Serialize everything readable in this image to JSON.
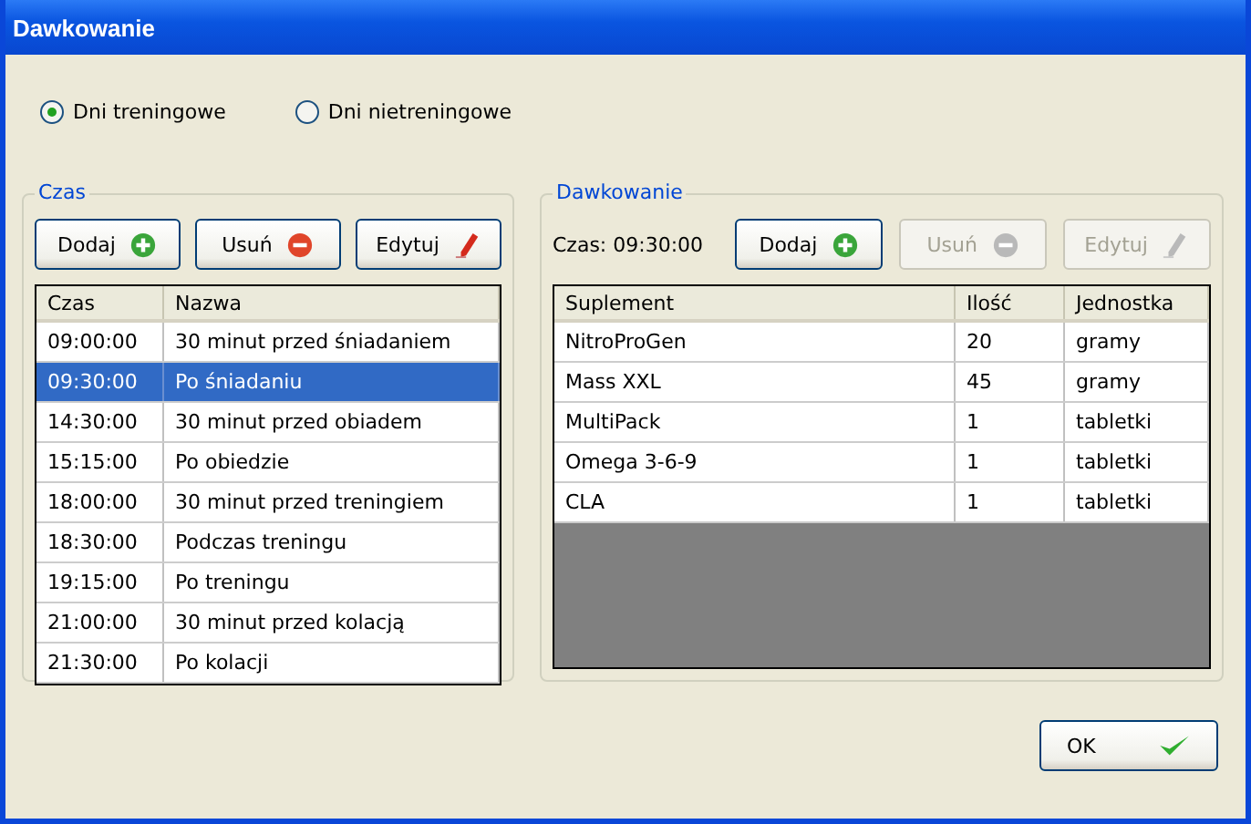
{
  "window": {
    "title": "Dawkowanie"
  },
  "day_types": [
    {
      "label": "Dni treningowe",
      "selected": true
    },
    {
      "label": "Dni nietreningowe",
      "selected": false
    }
  ],
  "time_group": {
    "title": "Czas",
    "buttons": [
      {
        "label": "Dodaj",
        "kind": "add",
        "disabled": false
      },
      {
        "label": "Usuń",
        "kind": "remove",
        "disabled": false
      },
      {
        "label": "Edytuj",
        "kind": "edit",
        "disabled": false
      }
    ],
    "table": {
      "columns": [
        "Czas",
        "Nazwa"
      ],
      "rows": [
        {
          "cells": [
            "09:00:00",
            "30 minut przed śniadaniem"
          ],
          "selected": false
        },
        {
          "cells": [
            "09:30:00",
            "Po śniadaniu"
          ],
          "selected": true
        },
        {
          "cells": [
            "14:30:00",
            "30 minut przed obiadem"
          ],
          "selected": false
        },
        {
          "cells": [
            "15:15:00",
            "Po obiedzie"
          ],
          "selected": false
        },
        {
          "cells": [
            "18:00:00",
            "30 minut przed treningiem"
          ],
          "selected": false
        },
        {
          "cells": [
            "18:30:00",
            "Podczas treningu"
          ],
          "selected": false
        },
        {
          "cells": [
            "19:15:00",
            "Po treningu"
          ],
          "selected": false
        },
        {
          "cells": [
            "21:00:00",
            "30 minut przed kolacją"
          ],
          "selected": false
        },
        {
          "cells": [
            "21:30:00",
            "Po kolacji"
          ],
          "selected": false
        }
      ]
    }
  },
  "dose_group": {
    "title": "Dawkowanie",
    "time_label": "Czas: 09:30:00",
    "buttons": [
      {
        "label": "Dodaj",
        "kind": "add",
        "disabled": false
      },
      {
        "label": "Usuń",
        "kind": "remove",
        "disabled": true
      },
      {
        "label": "Edytuj",
        "kind": "edit",
        "disabled": true
      }
    ],
    "table": {
      "columns": [
        "Suplement",
        "Ilość",
        "Jednostka"
      ],
      "rows": [
        {
          "cells": [
            "NitroProGen",
            "20",
            "gramy"
          ],
          "selected": false
        },
        {
          "cells": [
            "Mass XXL",
            "45",
            "gramy"
          ],
          "selected": false
        },
        {
          "cells": [
            "MultiPack",
            "1",
            "tabletki"
          ],
          "selected": false
        },
        {
          "cells": [
            "Omega 3-6-9",
            "1",
            "tabletki"
          ],
          "selected": false
        },
        {
          "cells": [
            "CLA",
            "1",
            "tabletki"
          ],
          "selected": false
        }
      ]
    }
  },
  "ok_button": {
    "label": "OK"
  }
}
